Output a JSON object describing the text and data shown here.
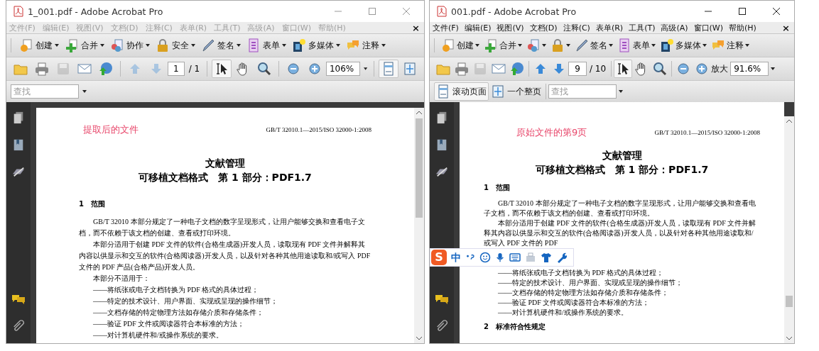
{
  "windows": [
    {
      "title": "1_001.pdf - Adobe Acrobat Pro",
      "active": false,
      "menu": [
        "文件(F)",
        "编辑(E)",
        "视图(V)",
        "文档(D)",
        "注释(C)",
        "表单(R)",
        "工具(T)",
        "高级(A)",
        "窗口(W)",
        "帮助(H)"
      ],
      "menu_close": "×",
      "tasks": [
        {
          "kind": "create",
          "label": "创建"
        },
        {
          "kind": "combine",
          "label": "合并"
        },
        {
          "kind": "collaborate",
          "label": "协作"
        },
        {
          "kind": "secure",
          "label": "安全"
        },
        {
          "kind": "sign",
          "label": "签名"
        },
        {
          "kind": "forms",
          "label": "表单"
        },
        {
          "kind": "multimedia",
          "label": "多媒体"
        },
        {
          "kind": "comment",
          "label": "注释"
        }
      ],
      "tools": [
        {
          "kind": "folder",
          "disabled": false
        },
        {
          "kind": "printer",
          "disabled": false
        },
        {
          "kind": "disk",
          "disabled": true
        },
        {
          "kind": "mail",
          "disabled": false
        },
        {
          "kind": "globe",
          "disabled": false
        },
        {
          "kind": "separator"
        },
        {
          "kind": "up",
          "disabled": true
        },
        {
          "kind": "down",
          "disabled": true
        },
        {
          "kind": "page_field",
          "value": "1",
          "total": "/ 1"
        },
        {
          "kind": "separator"
        },
        {
          "kind": "select",
          "disabled": false,
          "selected": true
        },
        {
          "kind": "hand",
          "disabled": false,
          "selected": false
        },
        {
          "kind": "zoom",
          "disabled": false,
          "selected": false
        },
        {
          "kind": "separator"
        },
        {
          "kind": "zoom_out",
          "disabled": false
        },
        {
          "kind": "zoom_in",
          "disabled": false
        },
        {
          "kind": "zoom_field",
          "value": "106%"
        },
        {
          "kind": "separator"
        },
        {
          "kind": "fit_width",
          "disabled": false,
          "selected": true
        },
        {
          "kind": "fit_page",
          "disabled": false,
          "selected": false
        }
      ],
      "find": {
        "placeholder": "查找"
      },
      "document": {
        "note": "提取后的文件",
        "header": "GB/T 32010.1—2015/ISO 32000-1:2008",
        "title": "文献管理",
        "subtitle": "可移植文档格式　第 1 部分：PDF1.7",
        "blocks": [
          {
            "kind": "heading",
            "text": "1　范围"
          },
          {
            "kind": "paragraph",
            "text": "GB/T 32010 本部分规定了一种电子文档的数字呈现形式，让用户能够交换和查看电子文档，而不依赖于该文档的创建、查看或打印环境。"
          },
          {
            "kind": "paragraph",
            "text": "本部分适用于创建 PDF 文件的软件(合格生成器)开发人员，读取现有 PDF 文件并解释其内容以供显示和交互的软件(合格阅读器)开发人员，以及针对各种其他用途读取和/或写入 PDF 文件的 PDF 产品(合格产品)开发人员。"
          },
          {
            "kind": "paragraph",
            "text": "本部分不适用于："
          },
          {
            "kind": "list_item",
            "text": "——将纸张或电子文档转换为 PDF 格式的具体过程；"
          },
          {
            "kind": "list_item",
            "text": "——特定的技术设计、用户界面、实现或呈现的操作细节；"
          },
          {
            "kind": "list_item",
            "text": "——文档存储的特定物理方法如存储介质和存储条件；"
          },
          {
            "kind": "list_item",
            "text": "——验证 PDF 文件或阅读器符合本标准的方法；"
          },
          {
            "kind": "list_item",
            "text": "——对计算机硬件和/或操作系统的要求。"
          }
        ]
      }
    },
    {
      "title": "001.pdf - Adobe Acrobat Pro",
      "active": true,
      "menu": [
        "文件(F)",
        "编辑(E)",
        "视图(V)",
        "文档(D)",
        "注释(C)",
        "表单(R)",
        "工具(T)",
        "高级(A)",
        "窗口(W)",
        "帮助(H)"
      ],
      "menu_close": "×",
      "tasks": [
        {
          "kind": "create",
          "label": "创建"
        },
        {
          "kind": "combine",
          "label": "合并"
        },
        {
          "kind": "collaborate"
        },
        {
          "kind": "secure"
        },
        {
          "kind": "sign",
          "label": "签名"
        },
        {
          "kind": "forms",
          "label": "表单"
        },
        {
          "kind": "multimedia",
          "label": "多媒体"
        },
        {
          "kind": "comment",
          "label": "注释"
        }
      ],
      "tools": [
        {
          "kind": "folder",
          "disabled": false
        },
        {
          "kind": "printer",
          "disabled": false
        },
        {
          "kind": "disk",
          "disabled": true
        },
        {
          "kind": "mail",
          "disabled": false
        },
        {
          "kind": "globe",
          "disabled": false
        },
        {
          "kind": "separator"
        },
        {
          "kind": "up",
          "disabled": false
        },
        {
          "kind": "down",
          "disabled": false
        },
        {
          "kind": "page_field",
          "value": "9",
          "total": "/ 10"
        },
        {
          "kind": "separator"
        },
        {
          "kind": "select",
          "disabled": false,
          "selected": true
        },
        {
          "kind": "hand",
          "disabled": false,
          "selected": false
        },
        {
          "kind": "zoom",
          "disabled": false,
          "selected": false
        },
        {
          "kind": "separator"
        },
        {
          "kind": "zoom_out",
          "disabled": false
        },
        {
          "kind": "zoom_in",
          "disabled": false,
          "label": "放大"
        },
        {
          "kind": "zoom_field",
          "value": "91.6%"
        }
      ],
      "views": [
        {
          "kind": "fit_width",
          "label": "滚动页面",
          "selected": true
        },
        {
          "kind": "fit_page",
          "label": "一个整页",
          "selected": false
        }
      ],
      "find": {
        "placeholder": "查找"
      },
      "document": {
        "previous_page_end": true,
        "note": "原始文件的第9页",
        "header": "GB/T 32010.1—2015/ISO 32000-1:2008",
        "title": "文献管理",
        "subtitle": "可移植文档格式　第 1 部分：PDF1.7",
        "blocks": [
          {
            "kind": "heading",
            "text": "1　范围"
          },
          {
            "kind": "paragraph",
            "text": "GB/T 32010 本部分规定了一种电子文档的数字呈现形式，让用户能够交换和查看电子文档，而不依赖于该文档的创建、查看或打印环境。"
          },
          {
            "kind": "paragraph",
            "text": "本部分适用于创建 PDF 文件的软件(合格生成器)开发人员，读取现有 PDF 文件并解释其内容以供显示和交互的软件(合格阅读器)开发人员，以及针对各种其他用途读取和/或写入 PDF 文件的 PDF"
          },
          {
            "kind": "ime_bar",
            "logo": "S",
            "mode": "中"
          },
          {
            "kind": "list_item",
            "text": "——将纸张或电子文档转换为 PDF 格式的具体过程；"
          },
          {
            "kind": "list_item",
            "text": "——特定的技术设计、用户界面、实现或呈现的操作细节；"
          },
          {
            "kind": "list_item",
            "text": "——文档存储的特定物理方法如存储介质和存储条件；"
          },
          {
            "kind": "list_item",
            "text": "——验证 PDF 文件或阅读器符合本标准的方法；"
          },
          {
            "kind": "list_item",
            "text": "——对计算机硬件和/或操作系统的要求。"
          },
          {
            "kind": "heading",
            "text": "2　标准符合性规定"
          }
        ]
      }
    }
  ]
}
